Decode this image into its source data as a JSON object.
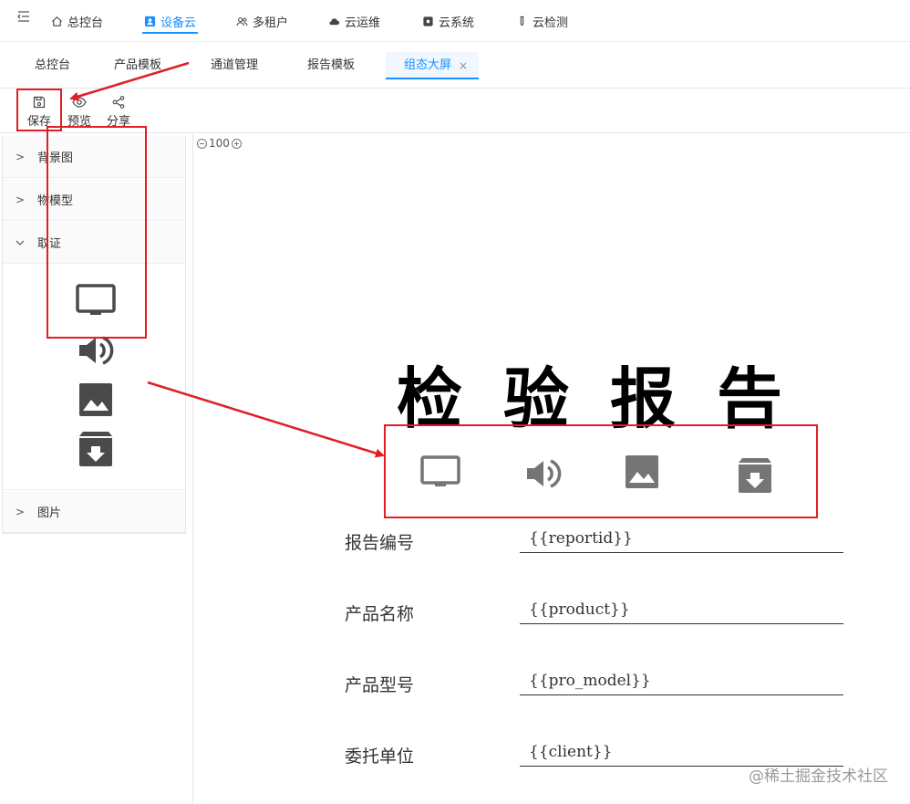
{
  "topnav": {
    "collapse_icon": "collapse-left-icon",
    "items": [
      {
        "label": "总控台",
        "icon": "home-icon"
      },
      {
        "label": "设备云",
        "icon": "device-icon",
        "active": true
      },
      {
        "label": "多租户",
        "icon": "users-icon"
      },
      {
        "label": "云运维",
        "icon": "cloud-icon"
      },
      {
        "label": "云系统",
        "icon": "system-icon"
      },
      {
        "label": "云检测",
        "icon": "test-tube-icon"
      }
    ]
  },
  "tabs": {
    "items": [
      {
        "label": "总控台"
      },
      {
        "label": "产品模板"
      },
      {
        "label": "通道管理"
      },
      {
        "label": "报告模板"
      },
      {
        "label": "组态大屏",
        "active": true,
        "close": "×"
      }
    ]
  },
  "toolbar": {
    "save_label": "保存",
    "preview_label": "预览",
    "share_label": "分享"
  },
  "sidebar": {
    "sections": [
      {
        "label": "背景图",
        "state": "collapsed"
      },
      {
        "label": "物模型",
        "state": "collapsed"
      },
      {
        "label": "取证",
        "state": "expanded"
      },
      {
        "label": "图片",
        "state": "collapsed"
      }
    ],
    "components": [
      "monitor-icon",
      "volume-icon",
      "image-icon",
      "archive-download-icon"
    ]
  },
  "canvas": {
    "zoom": "100",
    "title_chars": [
      "检",
      "验",
      "报",
      "告"
    ],
    "fields": [
      {
        "label": "报告编号",
        "value": "{{reportid}}"
      },
      {
        "label": "产品名称",
        "value": "{{product}}"
      },
      {
        "label": "产品型号",
        "value": "{{pro_model}}"
      },
      {
        "label": "委托单位",
        "value": "{{client}}"
      }
    ]
  },
  "watermark": "@稀土掘金技术社区",
  "colors": {
    "accent": "#1890ff",
    "annotation": "#e01e25",
    "icon_dark": "#4a4a4a",
    "icon_gray": "#757575"
  }
}
